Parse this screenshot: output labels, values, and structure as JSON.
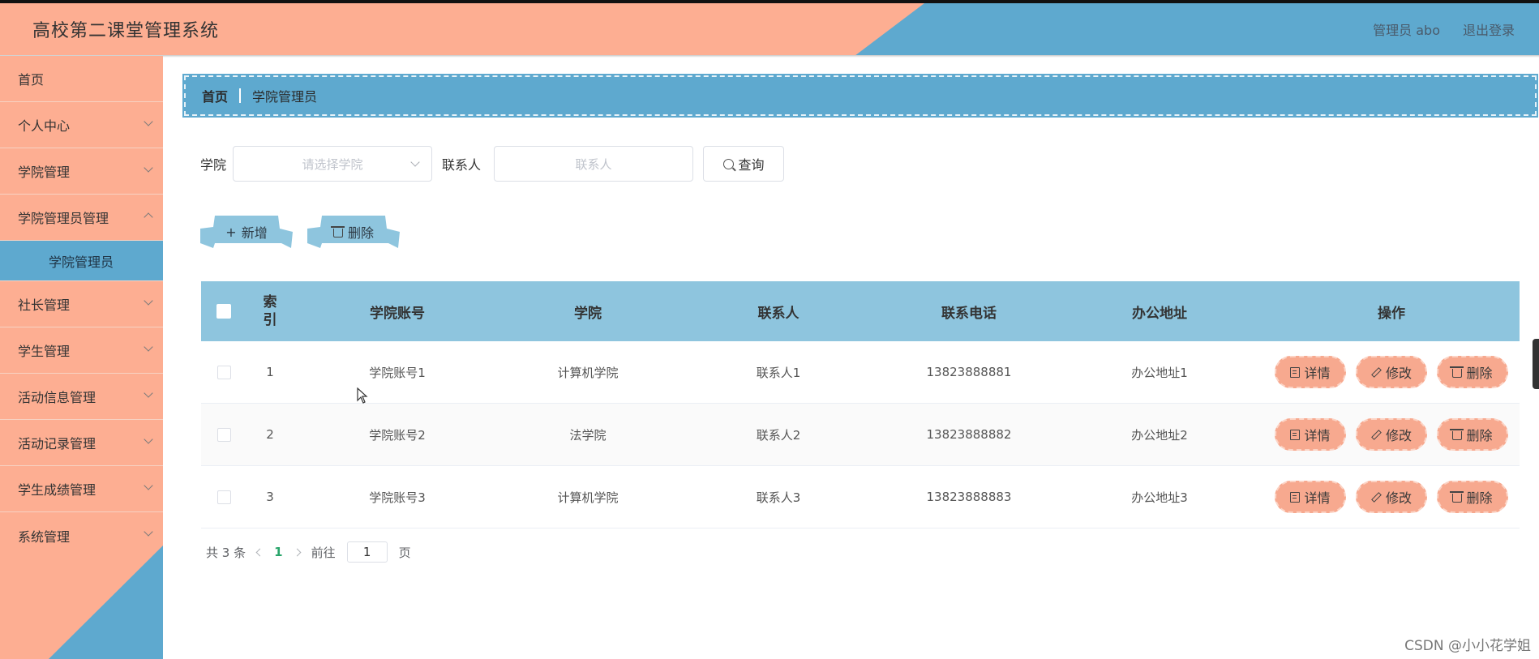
{
  "header": {
    "title": "高校第二课堂管理系统",
    "user_label": "管理员 abo",
    "logout_label": "退出登录"
  },
  "sidebar": {
    "items": [
      {
        "label": "首页"
      },
      {
        "label": "个人中心"
      },
      {
        "label": "学院管理"
      },
      {
        "label": "学院管理员管理"
      },
      {
        "label": "学院管理员"
      },
      {
        "label": "社长管理"
      },
      {
        "label": "学生管理"
      },
      {
        "label": "活动信息管理"
      },
      {
        "label": "活动记录管理"
      },
      {
        "label": "学生成绩管理"
      },
      {
        "label": "系统管理"
      }
    ]
  },
  "breadcrumb": {
    "home": "首页",
    "current": "学院管理员"
  },
  "filters": {
    "college_label": "学院",
    "college_placeholder": "请选择学院",
    "contact_label": "联系人",
    "contact_placeholder": "联系人",
    "search_label": "查询"
  },
  "actions": {
    "add_label": "新增",
    "delete_label": "删除"
  },
  "table": {
    "headers": {
      "index": "索引",
      "account": "学院账号",
      "college": "学院",
      "contact": "联系人",
      "phone": "联系电话",
      "address": "办公地址",
      "ops": "操作"
    },
    "rows": [
      {
        "index": "1",
        "account": "学院账号1",
        "college": "计算机学院",
        "contact": "联系人1",
        "phone": "13823888881",
        "address": "办公地址1"
      },
      {
        "index": "2",
        "account": "学院账号2",
        "college": "法学院",
        "contact": "联系人2",
        "phone": "13823888882",
        "address": "办公地址2"
      },
      {
        "index": "3",
        "account": "学院账号3",
        "college": "计算机学院",
        "contact": "联系人3",
        "phone": "13823888883",
        "address": "办公地址3"
      }
    ],
    "op_labels": {
      "detail": "详情",
      "edit": "修改",
      "delete": "删除"
    }
  },
  "pagination": {
    "total_prefix": "共",
    "total": "3",
    "total_suffix": "条",
    "current_page": "1",
    "goto_prefix": "前往",
    "goto_value": "1",
    "goto_suffix": "页"
  },
  "watermark": "CSDN @小小花学姐",
  "colors": {
    "accent_blue": "#5ea9cf",
    "accent_salmon": "#fdae92",
    "table_header": "#8ec5de",
    "op_button": "#f7a98f"
  }
}
